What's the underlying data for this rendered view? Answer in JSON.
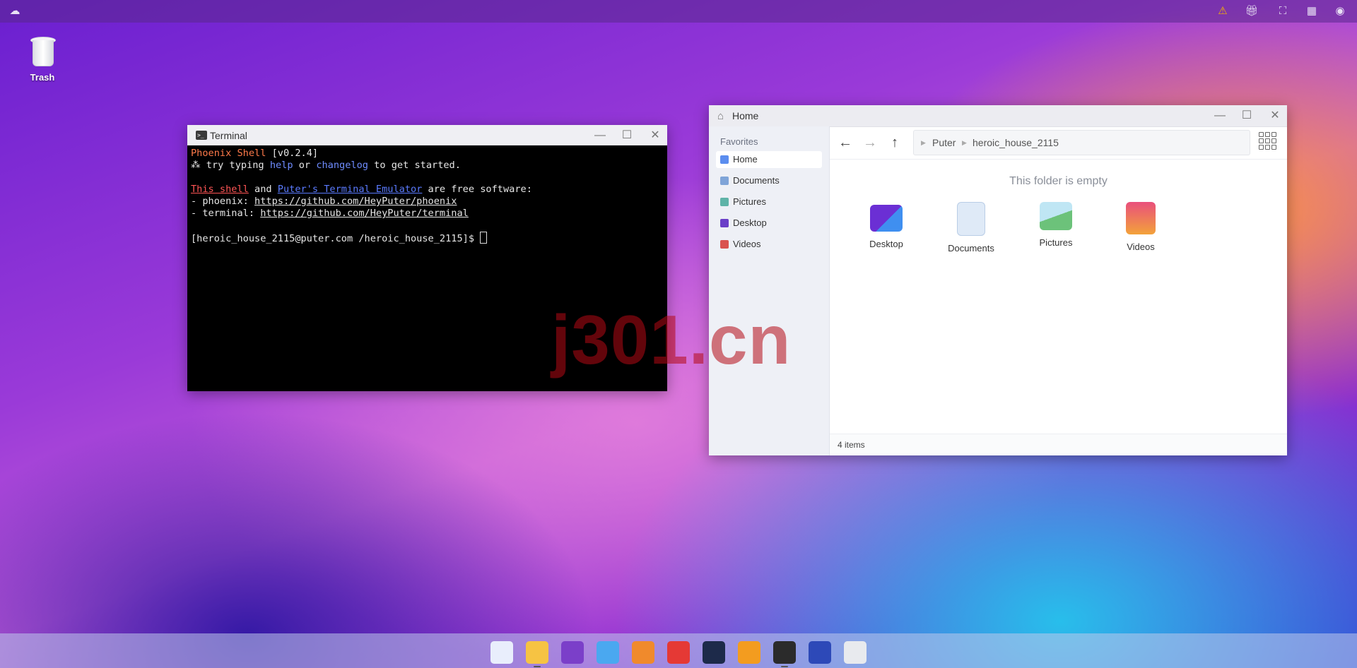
{
  "topbar": {
    "logo_icon": "puter-logo-icon",
    "right_icons": [
      "warning-icon",
      "gift-icon",
      "fullscreen-icon",
      "qr-code-icon",
      "user-account-icon"
    ]
  },
  "desktop": {
    "trash_label": "Trash"
  },
  "terminal": {
    "title": "Terminal",
    "lines": {
      "l1_name": "Phoenix Shell",
      "l1_version": " [v0.2.4]",
      "l2_prefix": " try typing ",
      "l2_help": "help",
      "l2_or": " or ",
      "l2_changelog": "changelog",
      "l2_suffix": " to get started.",
      "l4_shell": "This shell",
      "l4_and": " and ",
      "l4_emulator": "Puter's Terminal Emulator",
      "l4_suffix": " are free software:",
      "l5_prefix": "- phoenix: ",
      "l5_url": "https://github.com/HeyPuter/phoenix",
      "l6_prefix": "- terminal: ",
      "l6_url": "https://github.com/HeyPuter/terminal",
      "prompt": "[heroic_house_2115@puter.com /heroic_house_2115]$ "
    }
  },
  "files": {
    "title": "Home",
    "sidebar": {
      "heading": "Favorites",
      "items": [
        {
          "label": "Home",
          "color": "#5b8def"
        },
        {
          "label": "Documents",
          "color": "#7fa4d8"
        },
        {
          "label": "Pictures",
          "color": "#5fb3a8"
        },
        {
          "label": "Desktop",
          "color": "#6a3fc8"
        },
        {
          "label": "Videos",
          "color": "#d9534f"
        }
      ]
    },
    "breadcrumb": [
      "Puter",
      "heroic_house_2115"
    ],
    "empty_message": "This folder is empty",
    "items": [
      {
        "label": "Desktop"
      },
      {
        "label": "Documents"
      },
      {
        "label": "Pictures"
      },
      {
        "label": "Videos"
      }
    ],
    "status": "4 items"
  },
  "watermark": "j301.cn",
  "taskbar": {
    "apps": [
      {
        "name": "app-launcher-icon",
        "color": "#e9eefc"
      },
      {
        "name": "files-icon",
        "color": "#f6c343"
      },
      {
        "name": "editor-icon",
        "color": "#7b3fc9"
      },
      {
        "name": "cubes-icon",
        "color": "#4aa8f0"
      },
      {
        "name": "draw-icon",
        "color": "#f08a2c"
      },
      {
        "name": "code-icon",
        "color": "#e53935"
      },
      {
        "name": "camera-icon",
        "color": "#1d2a4a"
      },
      {
        "name": "recorder-icon",
        "color": "#f39c1f"
      },
      {
        "name": "terminal-icon",
        "color": "#2b2b2b"
      },
      {
        "name": "puter-icon",
        "color": "#2d49b8"
      },
      {
        "name": "trash-icon",
        "color": "#e8eaee"
      }
    ]
  }
}
